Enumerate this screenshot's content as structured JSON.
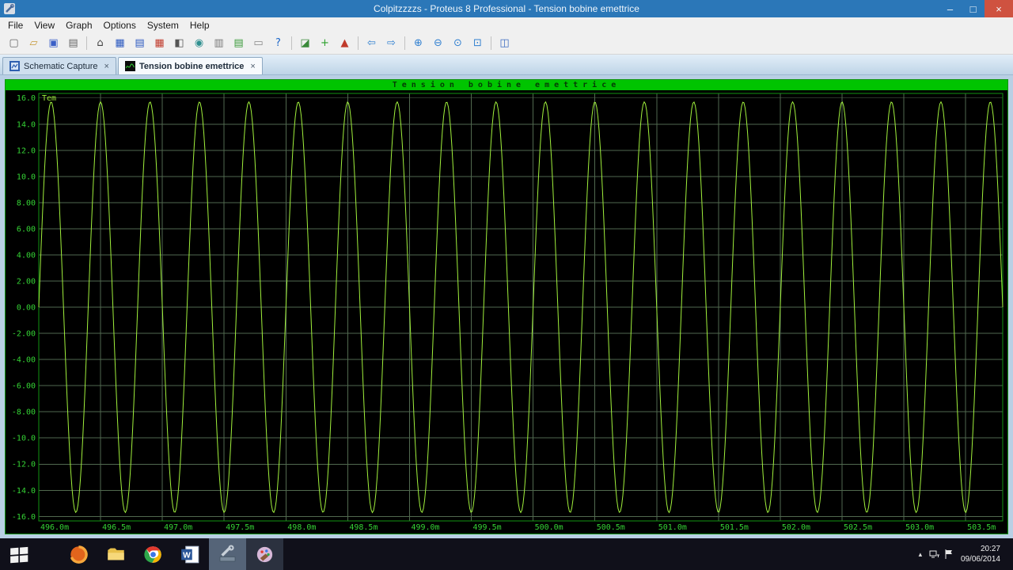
{
  "titlebar": {
    "title": "Colpitzzzzs - Proteus 8 Professional - Tension bobine emettrice",
    "minimize_glyph": "–",
    "restore_glyph": "□",
    "close_glyph": "×"
  },
  "menu": {
    "items": [
      "File",
      "View",
      "Graph",
      "Options",
      "System",
      "Help"
    ]
  },
  "toolbar": {
    "groups": [
      [
        {
          "name": "new-project",
          "glyph": "▢",
          "color": "#666666"
        },
        {
          "name": "open-project",
          "glyph": "▱",
          "color": "#c79a3a"
        },
        {
          "name": "save-project",
          "glyph": "▣",
          "color": "#3a5fc7"
        },
        {
          "name": "import-project",
          "glyph": "▤",
          "color": "#666666"
        }
      ],
      [
        {
          "name": "home-page",
          "glyph": "⌂",
          "color": "#444444"
        },
        {
          "name": "schematic-capture",
          "glyph": "▦",
          "color": "#2b59c0"
        },
        {
          "name": "bill-of-materials",
          "glyph": "▤",
          "color": "#2b59c0"
        },
        {
          "name": "pcb-layout",
          "glyph": "▦",
          "color": "#c03a2b"
        },
        {
          "name": "3d-visualizer",
          "glyph": "◧",
          "color": "#555555"
        },
        {
          "name": "design-explorer",
          "glyph": "◉",
          "color": "#2f8f8f"
        },
        {
          "name": "new-sheet",
          "glyph": "▥",
          "color": "#777777"
        },
        {
          "name": "design-notes",
          "glyph": "▤",
          "color": "#3a9a3a"
        },
        {
          "name": "measure",
          "glyph": "▭",
          "color": "#888888"
        },
        {
          "name": "help",
          "glyph": "?",
          "color": "#1c66c8"
        }
      ],
      [
        {
          "name": "edit-graph",
          "glyph": "◪",
          "color": "#3a8a3a"
        },
        {
          "name": "add-trace",
          "glyph": "+",
          "color": "#2aa02a"
        },
        {
          "name": "simulate-graph",
          "glyph": "▲",
          "color": "#c03a2b"
        }
      ],
      [
        {
          "name": "back",
          "glyph": "⇦",
          "color": "#2f7fd0"
        },
        {
          "name": "forward",
          "glyph": "⇨",
          "color": "#2f7fd0"
        }
      ],
      [
        {
          "name": "zoom-in",
          "glyph": "⊕",
          "color": "#2f7fd0"
        },
        {
          "name": "zoom-out",
          "glyph": "⊖",
          "color": "#2f7fd0"
        },
        {
          "name": "zoom-extents",
          "glyph": "⊙",
          "color": "#2f7fd0"
        },
        {
          "name": "zoom-area",
          "glyph": "⊡",
          "color": "#2f7fd0"
        }
      ],
      [
        {
          "name": "analysis-graph",
          "glyph": "◫",
          "color": "#3a6ac0"
        }
      ]
    ]
  },
  "tabs_close_glyph": "×",
  "tabs": [
    {
      "name": "tab-schematic-capture",
      "label": "Schematic Capture",
      "icon": "isis",
      "active": false
    },
    {
      "name": "tab-tension-bobine-emettrice",
      "label": "Tension bobine emettrice",
      "icon": "graph",
      "active": true
    }
  ],
  "graph": {
    "title": "Tension bobine emettrice",
    "trace_label": "Tem"
  },
  "chart_data": {
    "type": "line",
    "title": "Tension bobine emettrice",
    "legend": [
      "Tem"
    ],
    "x_unit": "m (milliseconds)",
    "x_range": [
      496.0,
      503.8
    ],
    "ylim": [
      -16.35,
      16.35
    ],
    "x_tick_step": 0.5,
    "y_tick_step": 2,
    "grid": true,
    "x_tick_values": [
      496.0,
      496.5,
      497.0,
      497.5,
      498.0,
      498.5,
      499.0,
      499.5,
      500.0,
      500.5,
      501.0,
      501.5,
      502.0,
      502.5,
      503.0,
      503.5
    ],
    "x_tick_labels": [
      "496.0m",
      "496.5m",
      "497.0m",
      "497.5m",
      "498.0m",
      "498.5m",
      "499.0m",
      "499.5m",
      "500.0m",
      "500.5m",
      "501.0m",
      "501.5m",
      "502.0m",
      "502.5m",
      "503.0m",
      "503.5m"
    ],
    "y_tick_values": [
      16,
      14,
      12,
      10,
      8,
      6,
      4,
      2,
      0,
      -2,
      -4,
      -6,
      -8,
      -10,
      -12,
      -14,
      -16
    ],
    "y_tick_labels": [
      "16.0",
      "14.0",
      "12.0",
      "10.0",
      "8.00",
      "6.00",
      "4.00",
      "2.00",
      "0.00",
      "-2.00",
      "-4.00",
      "-6.00",
      "-8.00",
      "-10.0",
      "-12.0",
      "-14.0",
      "-16.0"
    ],
    "series": [
      {
        "name": "Tem",
        "waveform": "sine",
        "amplitude": 15.7,
        "period": 0.4,
        "peak_at": 496.1
      }
    ],
    "colors": {
      "background": "#000000",
      "grid": "#51694f",
      "frame": "#129412",
      "axis_text": "#35d435",
      "trace": "#a0f03c",
      "title_bg": "#00c400",
      "title_text": "#053a05"
    }
  },
  "taskbar": {
    "apps": [
      {
        "name": "start",
        "icon": "windows",
        "active": false
      },
      {
        "name": "browser",
        "icon": "browser",
        "active": false
      },
      {
        "name": "file-explorer",
        "icon": "explorer",
        "active": false
      },
      {
        "name": "chrome",
        "icon": "chrome",
        "active": false
      },
      {
        "name": "word",
        "icon": "word",
        "active": false
      },
      {
        "name": "proteus",
        "icon": "proteus",
        "active": true
      },
      {
        "name": "image-editor",
        "icon": "paint",
        "open": true
      }
    ],
    "tray": {
      "time": "20:27",
      "date": "09/06/2014",
      "icons": [
        {
          "name": "hidden-icons-chevron",
          "glyph": "▴"
        },
        {
          "name": "network-icon",
          "svg": "network"
        },
        {
          "name": "action-center-flag-icon",
          "svg": "flag"
        }
      ]
    }
  }
}
